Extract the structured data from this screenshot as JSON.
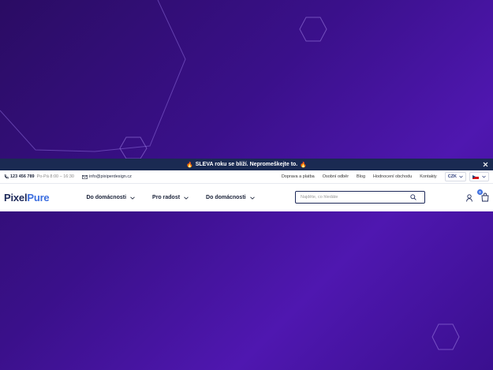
{
  "announcement": {
    "fire_left": "🔥",
    "text": "SLEVA roku se blíží. Nepromeškejte to.",
    "fire_right": "🔥"
  },
  "info": {
    "phone": "123 456 789",
    "hours": "Po-Pá 8:00 – 16:30",
    "email": "info@pixiperdesign.cz",
    "links": [
      "Doprava a platba",
      "Osobní odběr",
      "Blog",
      "Hodnocení obchodu",
      "Kontakty"
    ],
    "currency": "CZK"
  },
  "header": {
    "logo_part1": "Pixel",
    "logo_part2": "Pure",
    "menu": [
      "Do domácnosti",
      "Pro radost",
      "Do domácnosti"
    ],
    "search_placeholder": "Najděte, co hledáte",
    "cart_count": "0"
  },
  "colors": {
    "brand_dark": "#1e2a5a",
    "brand_accent": "#3d6fe0",
    "announcement_bg": "#1a2a52",
    "background_purple": "#3a108a"
  }
}
